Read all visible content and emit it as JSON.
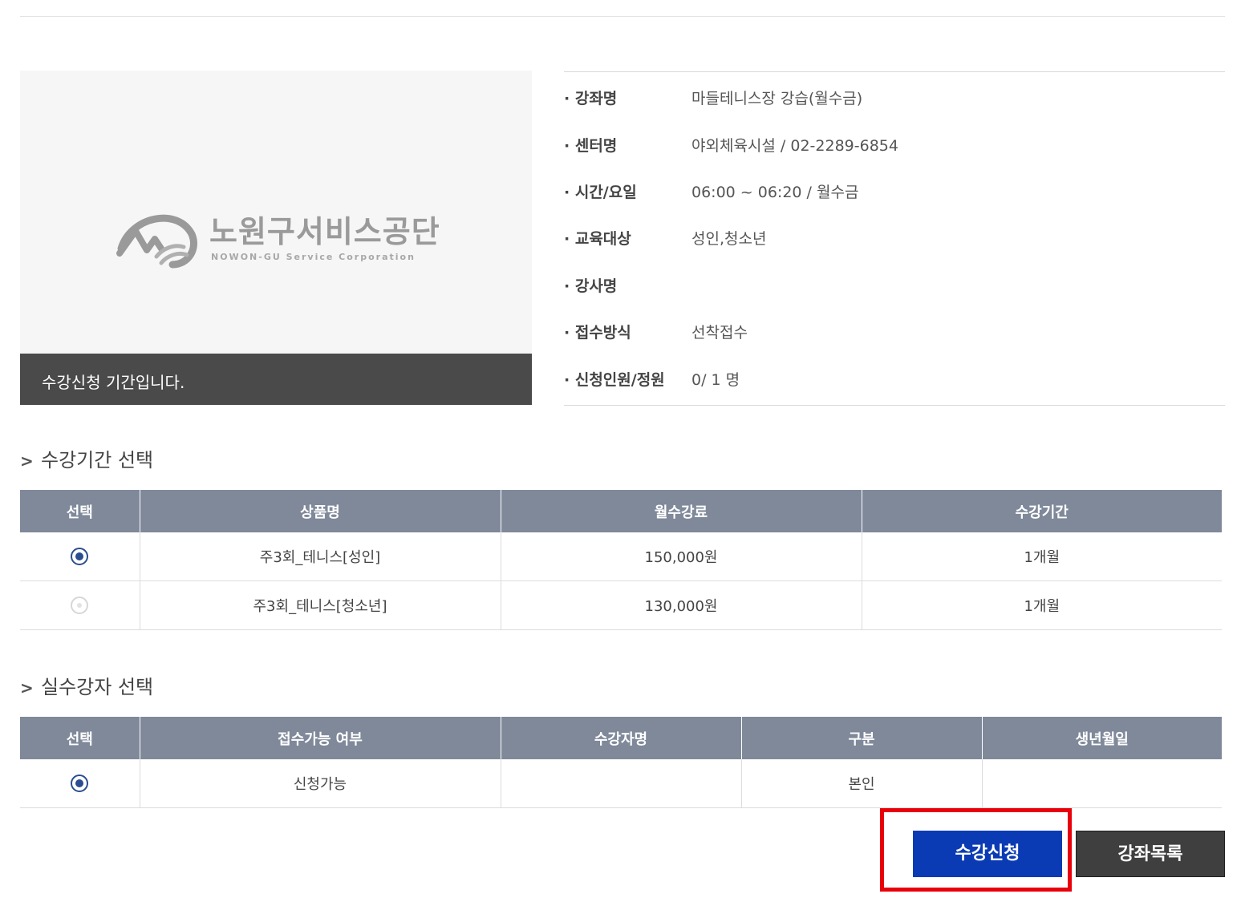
{
  "course_image": {
    "logo_name": "노원구서비스공단",
    "logo_sub": "NOWON-GU Service Corporation",
    "status": "수강신청 기간입니다."
  },
  "info": [
    {
      "label": "· 강좌명",
      "value": "마들테니스장 강습(월수금)"
    },
    {
      "label": "· 센터명",
      "value": "야외체육시설 / 02-2289-6854"
    },
    {
      "label": "· 시간/요일",
      "value": "06:00 ~ 06:20 / 월수금"
    },
    {
      "label": "· 교육대상",
      "value": "성인,청소년"
    },
    {
      "label": "· 강사명",
      "value": ""
    },
    {
      "label": "· 접수방식",
      "value": "선착접수"
    },
    {
      "label": "· 신청인원/정원",
      "value": "0/ 1 명"
    }
  ],
  "period_section": {
    "title": "수강기간 선택",
    "headers": [
      "선택",
      "상품명",
      "월수강료",
      "수강기간"
    ],
    "rows": [
      {
        "selected": true,
        "enabled": true,
        "product": "주3회_테니스[성인]",
        "fee": "150,000원",
        "period": "1개월"
      },
      {
        "selected": false,
        "enabled": false,
        "product": "주3회_테니스[청소년]",
        "fee": "130,000원",
        "period": "1개월"
      }
    ]
  },
  "student_section": {
    "title": "실수강자 선택",
    "headers": [
      "선택",
      "접수가능 여부",
      "수강자명",
      "구분",
      "생년월일"
    ],
    "rows": [
      {
        "selected": true,
        "availability": "신청가능",
        "name": "",
        "type": "본인",
        "birth": ""
      }
    ]
  },
  "buttons": {
    "apply": "수강신청",
    "list": "강좌목록"
  },
  "colors": {
    "table_header": "#7f899a",
    "apply_button": "#0b3bb4",
    "list_button": "#3f3f3f",
    "highlight_box": "#e8000b"
  }
}
